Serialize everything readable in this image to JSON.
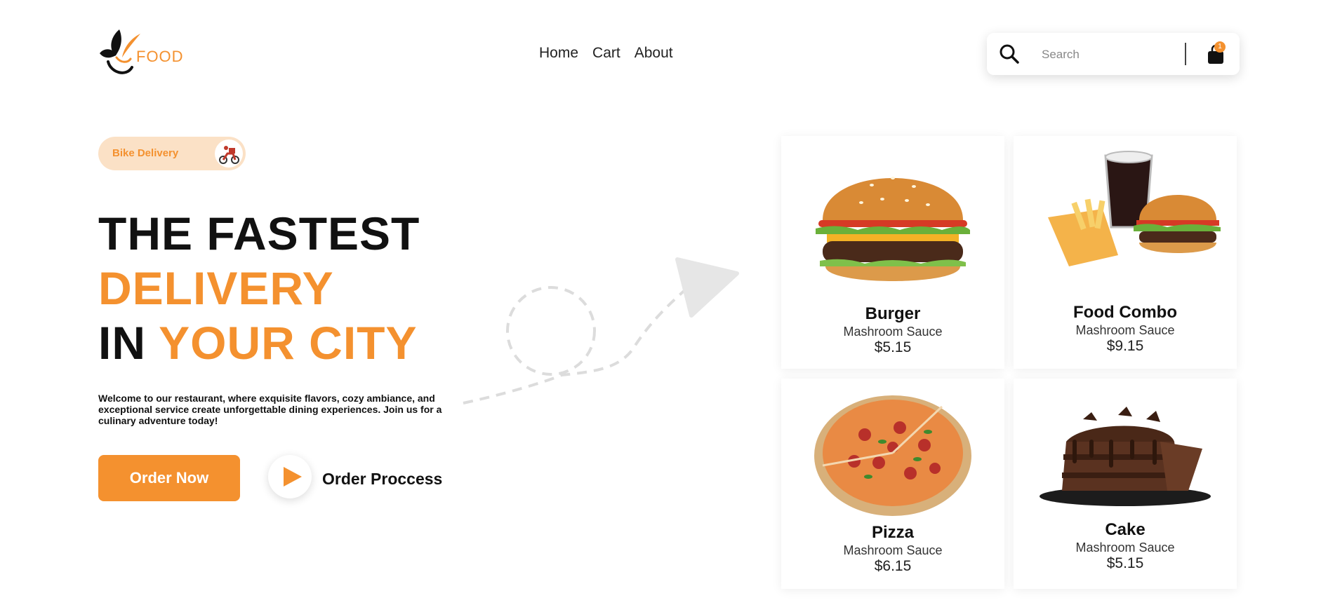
{
  "header": {
    "logo_text": "FOOD",
    "nav": [
      "Home",
      "Cart",
      "About"
    ],
    "search": {
      "placeholder": "Search"
    },
    "cart_count": "1"
  },
  "hero": {
    "badge_label": "Bike Delivery",
    "line1": "THE FASTEST",
    "line2": "DELIVERY",
    "line3_a": "IN",
    "line3_b": "YOUR CITY",
    "description": "Welcome to our restaurant, where exquisite flavors, cozy ambiance, and exceptional service create unforgettable dining experiences. Join us for a culinary adventure today!",
    "order_button": "Order Now",
    "process_label": "Order Proccess"
  },
  "items": [
    {
      "name": "Burger",
      "sauce": "Mashroom Sauce",
      "price": "$5.15"
    },
    {
      "name": "Food Combo",
      "sauce": "Mashroom Sauce",
      "price": "$9.15"
    },
    {
      "name": "Pizza",
      "sauce": "Mashroom Sauce",
      "price": "$6.15"
    },
    {
      "name": "Cake",
      "sauce": "Mashroom Sauce",
      "price": "$5.15"
    }
  ],
  "colors": {
    "accent": "#f4912f",
    "badge_bg": "#fbe1c6",
    "text": "#111111"
  },
  "icons": [
    "leaf-logo-icon",
    "search-icon",
    "shopping-bag-icon",
    "bike-delivery-icon",
    "play-icon"
  ]
}
